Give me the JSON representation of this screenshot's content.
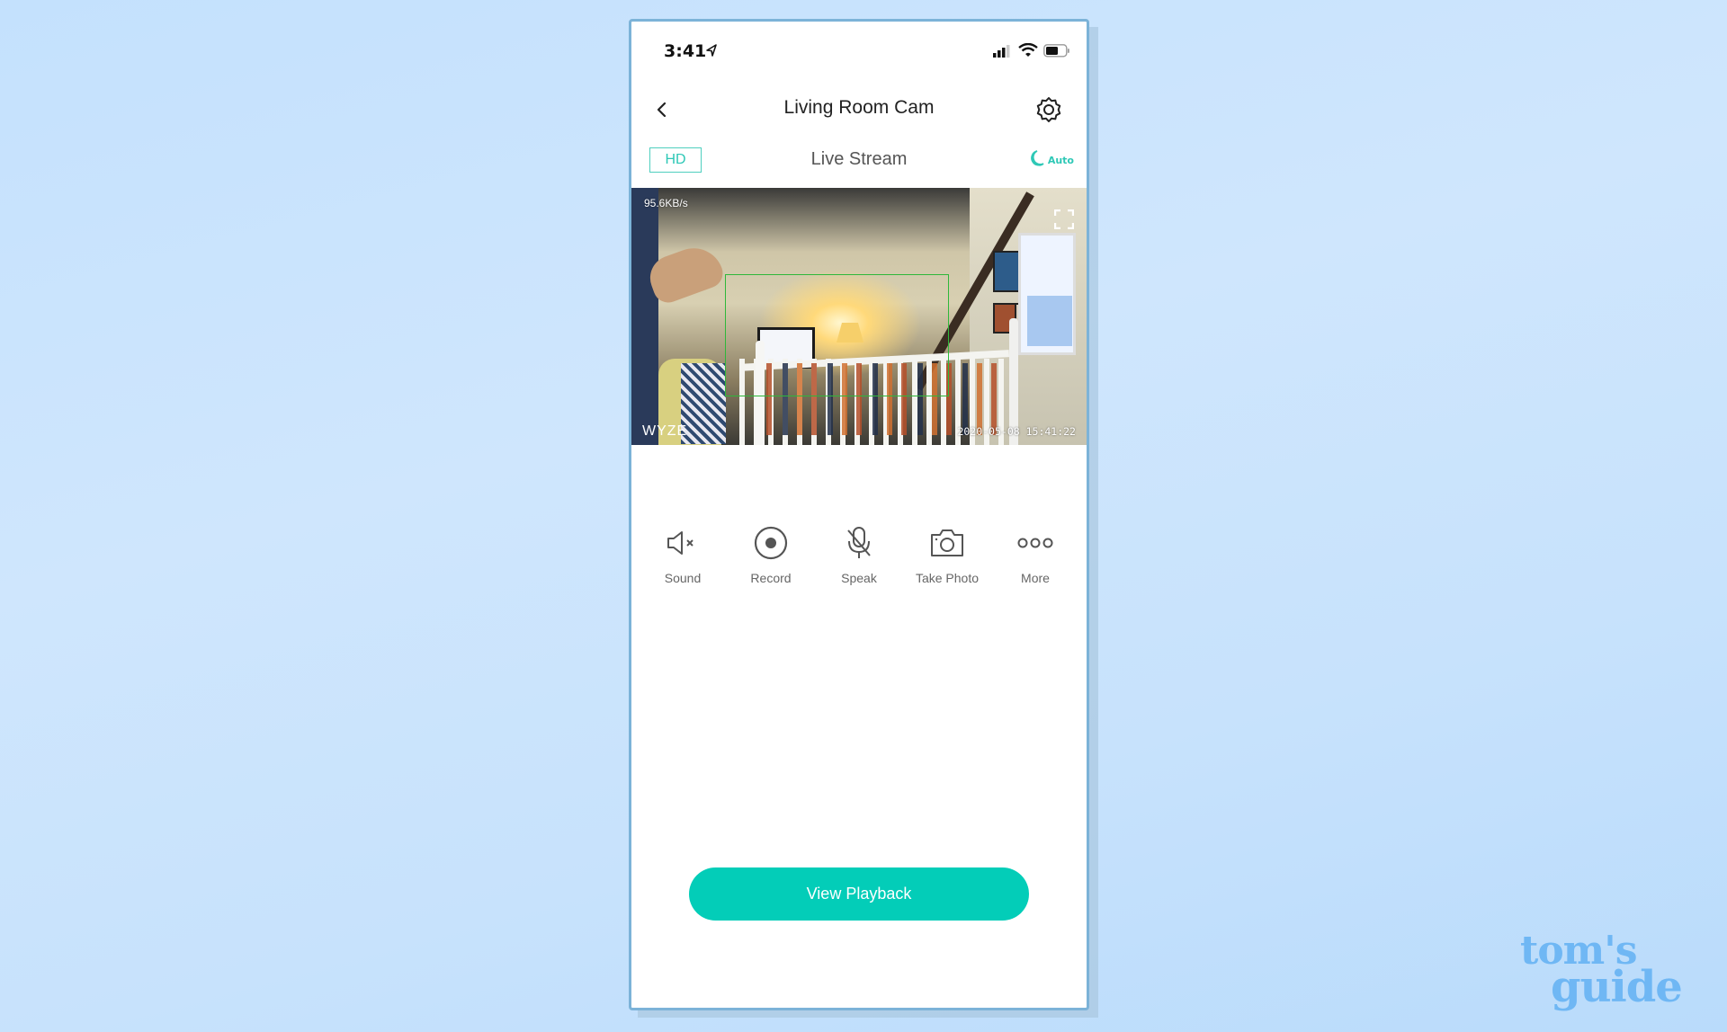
{
  "status_bar": {
    "time": "3:41",
    "icons": [
      "location-arrow-icon",
      "cellular-signal-icon",
      "wifi-icon",
      "battery-icon"
    ]
  },
  "header": {
    "title": "Living Room Cam",
    "back_icon": "chevron-left-icon",
    "settings_icon": "gear-icon"
  },
  "subheader": {
    "quality_label": "HD",
    "title": "Live Stream",
    "night_mode_label": "Auto",
    "night_mode_icon": "moon-icon"
  },
  "video": {
    "bitrate": "95.6KB/s",
    "watermark": "WYZE",
    "timestamp": "2020-05-08 15:41:22",
    "fullscreen_icon": "fullscreen-icon",
    "motion_box_color": "#2fb83a"
  },
  "controls": [
    {
      "label": "Sound",
      "icon": "speaker-muted-icon"
    },
    {
      "label": "Record",
      "icon": "record-icon"
    },
    {
      "label": "Speak",
      "icon": "microphone-muted-icon"
    },
    {
      "label": "Take Photo",
      "icon": "camera-icon"
    },
    {
      "label": "More",
      "icon": "more-dots-icon"
    }
  ],
  "playback_button": {
    "label": "View Playback",
    "color": "#03cdb8"
  },
  "branding": {
    "line1": "tom's",
    "line2": "guide"
  },
  "colors": {
    "accent": "#2ec8b6",
    "frame": "#7cb3d8"
  }
}
